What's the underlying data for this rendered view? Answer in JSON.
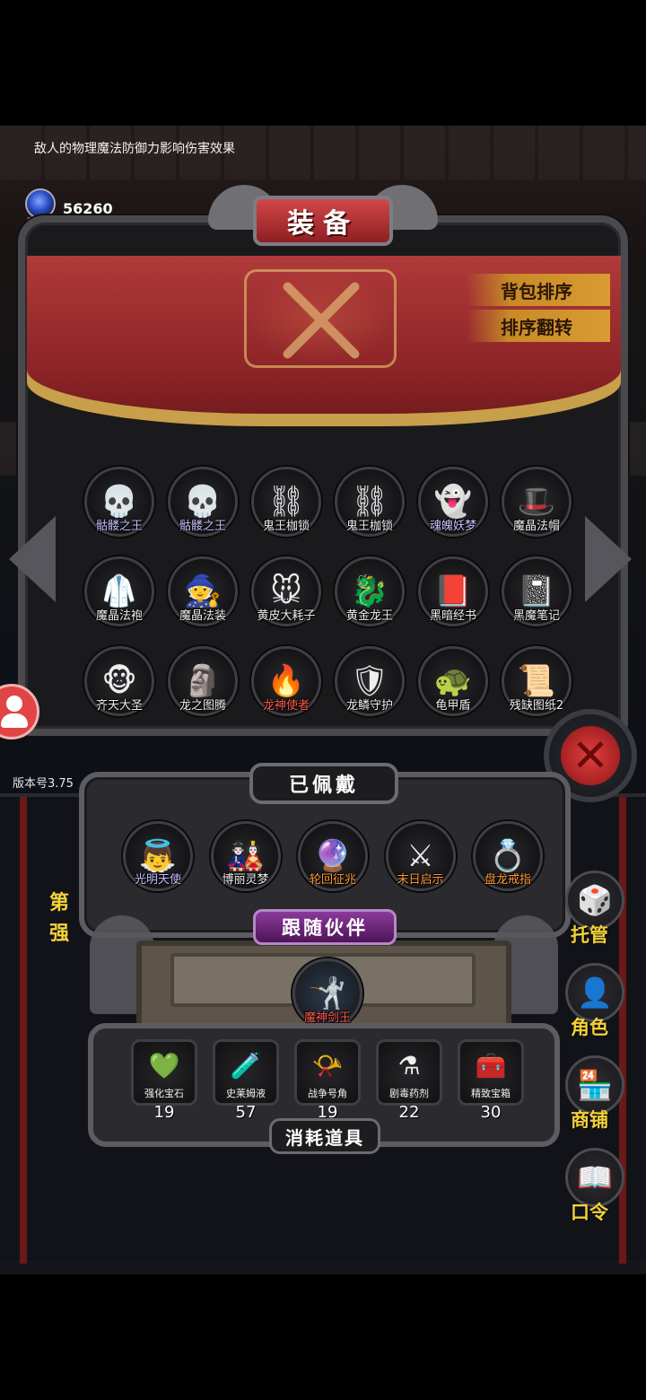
{
  "hint": "敌人的物理魔法防御力影响伤害效果",
  "currency": {
    "label": "宝石",
    "amount": "56260",
    "icon": "blue-gem-icon"
  },
  "header": {
    "title": "装备"
  },
  "sort": {
    "bag_sort": "背包排序",
    "sort_reverse": "排序翻转"
  },
  "inventory": [
    {
      "name": "骷髅之王",
      "glyph": "💀",
      "style": "blue"
    },
    {
      "name": "骷髅之王",
      "glyph": "💀",
      "style": "blue"
    },
    {
      "name": "鬼王枷锁",
      "glyph": "⛓",
      "style": ""
    },
    {
      "name": "鬼王枷锁",
      "glyph": "⛓",
      "style": ""
    },
    {
      "name": "魂魄妖梦",
      "glyph": "👻",
      "style": "blue"
    },
    {
      "name": "魔晶法帽",
      "glyph": "🎩",
      "style": ""
    },
    {
      "name": "魔晶法袍",
      "glyph": "🥼",
      "style": ""
    },
    {
      "name": "魔晶法装",
      "glyph": "🧙",
      "style": ""
    },
    {
      "name": "黄皮大耗子",
      "glyph": "🐭",
      "style": ""
    },
    {
      "name": "黄金龙王",
      "glyph": "🐉",
      "style": ""
    },
    {
      "name": "黑暗经书",
      "glyph": "📕",
      "style": ""
    },
    {
      "name": "黑魔笔记",
      "glyph": "📓",
      "style": ""
    },
    {
      "name": "齐天大圣",
      "glyph": "🐵",
      "style": ""
    },
    {
      "name": "龙之图腾",
      "glyph": "🗿",
      "style": ""
    },
    {
      "name": "龙神使者",
      "glyph": "🔥",
      "style": "red"
    },
    {
      "name": "龙鳞守护",
      "glyph": "🛡",
      "style": ""
    },
    {
      "name": "龟甲盾",
      "glyph": "🐢",
      "style": ""
    },
    {
      "name": "残缺图纸2",
      "glyph": "📜",
      "style": ""
    }
  ],
  "version": "版本号3.75",
  "equipped": {
    "title": "已佩戴",
    "items": [
      {
        "name": "光明天使",
        "glyph": "👼",
        "style": "blue"
      },
      {
        "name": "博丽灵梦",
        "glyph": "🎎",
        "style": ""
      },
      {
        "name": "轮回征兆",
        "glyph": "🔮",
        "style": "orange"
      },
      {
        "name": "末日启示",
        "glyph": "⚔",
        "style": "orange"
      },
      {
        "name": "盘龙戒指",
        "glyph": "💍",
        "style": "orange"
      }
    ]
  },
  "companion": {
    "title": "跟随伙伴",
    "name": "魔神剑王",
    "glyph": "🤺"
  },
  "consumables": {
    "title": "消耗道具",
    "items": [
      {
        "name": "强化宝石",
        "count": "19",
        "glyph": "💚"
      },
      {
        "name": "史莱姆液",
        "count": "57",
        "glyph": "🧪"
      },
      {
        "name": "战争号角",
        "count": "19",
        "glyph": "📯"
      },
      {
        "name": "剧毒药剂",
        "count": "22",
        "glyph": "⚗"
      },
      {
        "name": "精致宝箱",
        "count": "30",
        "glyph": "🧰"
      }
    ]
  },
  "side_text": {
    "line1": "第",
    "line2": "强"
  },
  "side_menu": [
    {
      "label": "托管",
      "glyph": "🎲"
    },
    {
      "label": "角色",
      "glyph": "👤"
    },
    {
      "label": "商铺",
      "glyph": "🏪"
    },
    {
      "label": "口令",
      "glyph": "📖"
    }
  ]
}
